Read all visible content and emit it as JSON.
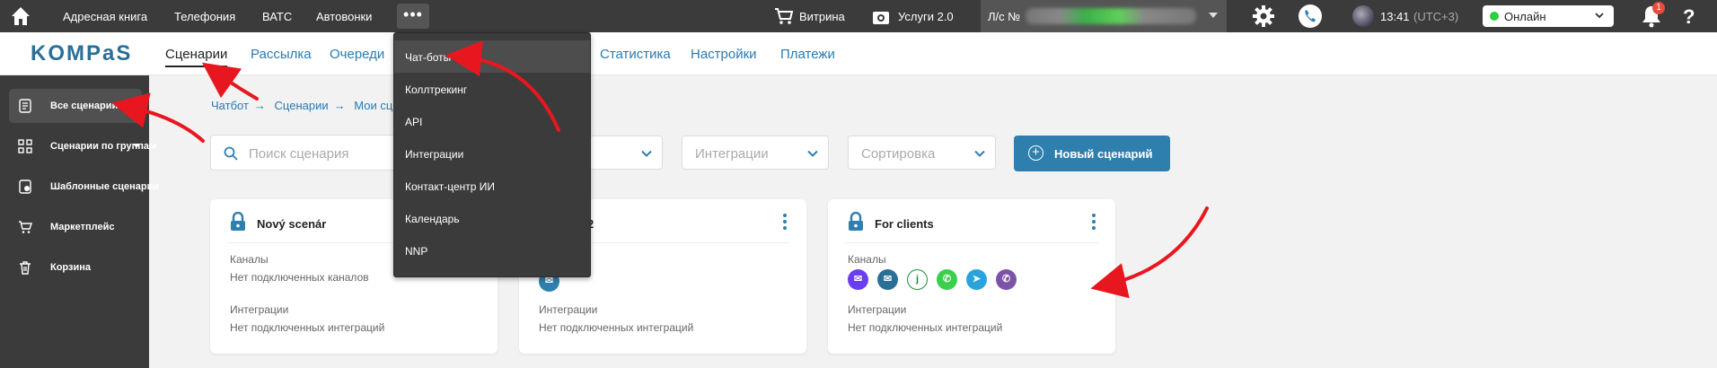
{
  "topbar": {
    "nav": [
      "Адресная книга",
      "Телефония",
      "ВАТС",
      "Автовонки"
    ],
    "more": "•••",
    "shop": "Витрина",
    "services": "Услуги 2.0",
    "account_label": "Л/с №",
    "time": "13:41",
    "tz": "(UTC+3)",
    "status": "Онлайн",
    "notifications": "1",
    "help": "?"
  },
  "logo": "KOMPaS",
  "subnav": [
    "Сценарии",
    "Рассылка",
    "Очереди",
    "Статистика",
    "Настройки",
    "Платежи"
  ],
  "sidebar": [
    {
      "label": "Все сценарии",
      "icon": "list-icon"
    },
    {
      "label": "Сценарии по группам",
      "icon": "grid-icon"
    },
    {
      "label": "Шаблонные сценарии",
      "icon": "template-icon"
    },
    {
      "label": "Маркетплейс",
      "icon": "cart-icon"
    },
    {
      "label": "Корзина",
      "icon": "trash-icon"
    }
  ],
  "breadcrumb": [
    "Чатбот",
    "Сценарии",
    "Мои сц"
  ],
  "filters": {
    "search_placeholder": "Поиск сценария",
    "integrations": "Интеграции",
    "sort": "Сортировка",
    "new_button": "Новый сценарий"
  },
  "dropdown": [
    "Чат-боты",
    "Коллтрекинг",
    "API",
    "Интеграции",
    "Контакт-центр ИИ",
    "Календарь",
    "NNP"
  ],
  "cards": [
    {
      "title": "Nový scenár",
      "channels_label": "Каналы",
      "channels_value": "Нет подключенных каналов",
      "integrations_label": "Интеграции",
      "integrations_value": "Нет подключенных интеграций"
    },
    {
      "title": "2",
      "channels_label": "",
      "channels_value": "",
      "integrations_label": "Интеграции",
      "integrations_value": "Нет подключенных интеграций"
    },
    {
      "title": "For clients",
      "channels_label": "Каналы",
      "channels_value": "",
      "integrations_label": "Интеграции",
      "integrations_value": "Нет подключенных интеграций"
    }
  ],
  "channel_icons": [
    "messenger-icon",
    "email-icon",
    "jivo-icon",
    "whatsapp-icon",
    "telegram-icon",
    "viber-icon"
  ],
  "channel_glyphs": [
    "✉",
    "✉",
    "j",
    "✆",
    "➤",
    "✆"
  ],
  "colors": {
    "accent": "#2f7fae",
    "topbar": "#3b3b3b",
    "arrow": "#e8171f",
    "online": "#2ecc40"
  }
}
